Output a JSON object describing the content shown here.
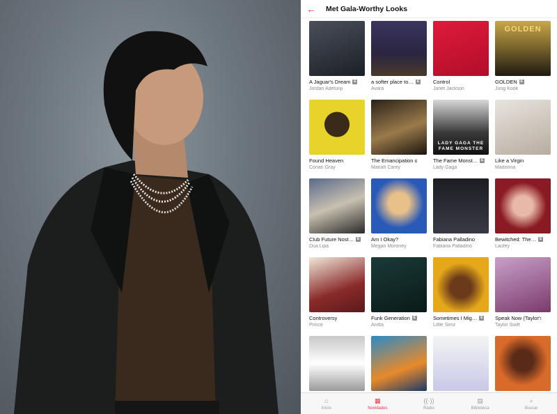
{
  "header": {
    "title": "Met Gala-Worthy Looks",
    "back_icon": "arrow-left-icon",
    "accent": "#fa2d48"
  },
  "albums": [
    {
      "title": "A Jaguar's Dream",
      "artist": "Jordan Adetunji",
      "explicit": true,
      "bg": "linear-gradient(160deg,#4a4f5a,#1c1f26)"
    },
    {
      "title": "a softer place to…",
      "artist": "Avara",
      "explicit": true,
      "bg": "linear-gradient(180deg,#3a3560 0%,#2b2540 60%,#4a3a2a 100%)"
    },
    {
      "title": "Control",
      "artist": "Janet Jackson",
      "explicit": false,
      "bg": "linear-gradient(160deg,#e01a3c,#b00e2a)"
    },
    {
      "title": "GOLDEN",
      "artist": "Jung Kook",
      "explicit": true,
      "bg": "linear-gradient(180deg,#c9a84a,#6d5a28 55%,#1e1a12)",
      "tag": "GOLDEN"
    },
    {
      "title": "Found Heaven",
      "artist": "Conan Gray",
      "explicit": false,
      "bg": "radial-gradient(circle at 50% 45%,#3a2a1a 30%,#e7d32a 31%)"
    },
    {
      "title": "The Emancipation of…",
      "artist": "Mariah Carey",
      "explicit": false,
      "bg": "linear-gradient(160deg,#2a2218,#9a7a4a 55%,#1a1510)"
    },
    {
      "title": "The Fame Monst…",
      "artist": "Lady Gaga",
      "explicit": true,
      "bg": "linear-gradient(180deg,#d8d8d8,#3a3a3a 60%,#111)",
      "tag": "LADY GAGA THE FAME MONSTER"
    },
    {
      "title": "Like a Virgin",
      "artist": "Madonna",
      "explicit": false,
      "bg": "linear-gradient(160deg,#e8e4de,#b7aca0)"
    },
    {
      "title": "Club Future Nost…",
      "artist": "Dua Lipa",
      "explicit": true,
      "bg": "linear-gradient(160deg,#5a6a8a,#c8c0b0 50%,#2a2a2a)"
    },
    {
      "title": "Am I Okay?",
      "artist": "Megan Moroney",
      "explicit": false,
      "bg": "radial-gradient(circle at 50% 45%,#e8c08a 25%,#2a5ab8 60%)"
    },
    {
      "title": "Fabiana Palladino",
      "artist": "Fabiana Palladino",
      "explicit": false,
      "bg": "linear-gradient(180deg,#1c1c22,#3a3a46)"
    },
    {
      "title": "Bewitched: The…",
      "artist": "Laufey",
      "explicit": true,
      "bg": "radial-gradient(circle at 50% 50%,#e8b8a8 25%,#8a1a24 60%)"
    },
    {
      "title": "Controversy",
      "artist": "Prince",
      "explicit": false,
      "bg": "linear-gradient(160deg,#f0e8d8,#8a2a2a 60%,#5a1a1a)"
    },
    {
      "title": "Funk Generation",
      "artist": "Anitta",
      "explicit": true,
      "bg": "linear-gradient(160deg,#1a3a38,#0a1a18)"
    },
    {
      "title": "Sometimes I Mig…",
      "artist": "Little Simz",
      "explicit": true,
      "bg": "radial-gradient(circle at 50% 55%,#6a3a1a 25%,#e6a81a 60%)"
    },
    {
      "title": "Speak Now (Taylor's…",
      "artist": "Taylor Swift",
      "explicit": false,
      "bg": "linear-gradient(160deg,#c8a0c8,#7a3a6a)"
    },
    {
      "title": "",
      "artist": "",
      "explicit": false,
      "bg": "linear-gradient(180deg,#c8c8c8,#ffffff 50%,#9a9a9a)"
    },
    {
      "title": "",
      "artist": "",
      "explicit": false,
      "bg": "linear-gradient(160deg,#2a8ac8,#e88a2a 60%,#1a3a6a)"
    },
    {
      "title": "",
      "artist": "",
      "explicit": false,
      "bg": "linear-gradient(180deg,#f4f4f4,#c8c8e8)"
    },
    {
      "title": "",
      "artist": "",
      "explicit": false,
      "bg": "radial-gradient(circle at 50% 45%,#5a2a18 25%,#d86a2a 60%)"
    }
  ],
  "tabbar": {
    "tabs": [
      {
        "label": "Início",
        "icon": "home-icon",
        "glyph": "⌂",
        "active": false
      },
      {
        "label": "Novidades",
        "icon": "grid-icon",
        "glyph": "▦",
        "active": true
      },
      {
        "label": "Rádio",
        "icon": "radio-icon",
        "glyph": "((·))",
        "active": false
      },
      {
        "label": "Biblioteca",
        "icon": "library-icon",
        "glyph": "▤",
        "active": false
      },
      {
        "label": "Buscar",
        "icon": "search-icon",
        "glyph": "⌕",
        "active": false
      }
    ]
  }
}
